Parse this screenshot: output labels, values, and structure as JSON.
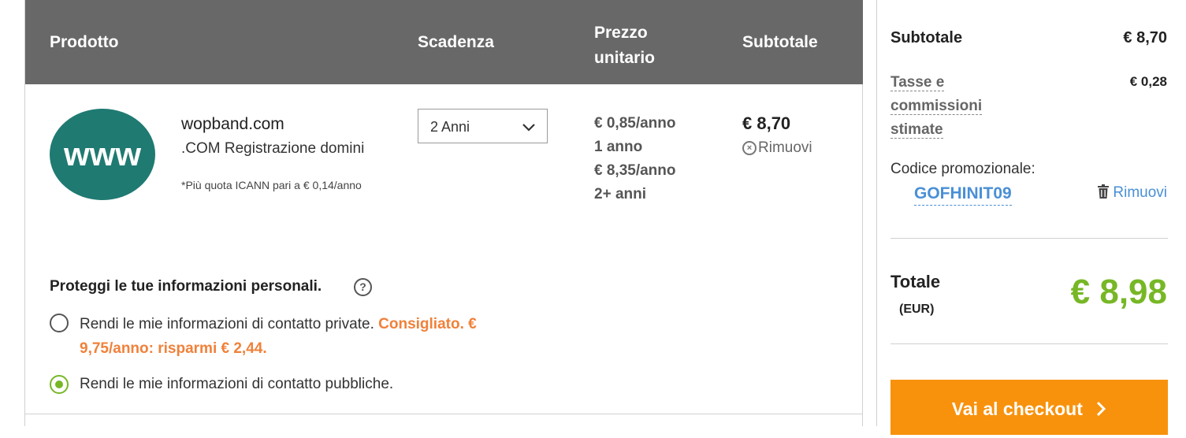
{
  "table": {
    "headers": {
      "product": "Prodotto",
      "expiry": "Scadenza",
      "unit_price": "Prezzo unitario",
      "subtotal": "Subtotale"
    }
  },
  "item": {
    "logo_text": "www",
    "name": "wopband.com",
    "type": ".COM Registrazione domini",
    "note": "*Più quota ICANN pari a € 0,14/anno",
    "duration_selected": "2 Anni",
    "prices": [
      "€ 0,85/anno",
      "1 anno",
      "€ 8,35/anno",
      "2+ anni"
    ],
    "subtotal": "€ 8,70",
    "remove_label": "Rimuovi"
  },
  "privacy": {
    "title": "Proteggi le tue informazioni personali.",
    "help_icon": "?",
    "option_private": "Rendi le mie informazioni di contatto private.",
    "option_private_recommended": "Consigliato. € 9,75/anno: risparmi € 2,44.",
    "option_public": "Rendi le mie informazioni di contatto pubbliche.",
    "selected": "public"
  },
  "summary": {
    "subtotal_label": "Subtotale",
    "subtotal_value": "€ 8,70",
    "tax_label": "Tasse e commissioni stimate",
    "tax_value": "€ 0,28",
    "promo_label": "Codice promozionale:",
    "promo_code": "GOFHINIT09",
    "promo_remove_label": "Rimuovi",
    "total_label": "Totale",
    "total_currency": "(EUR)",
    "total_value": "€ 8,98",
    "checkout_label": "Vai al checkout"
  },
  "colors": {
    "header_bg": "#686868",
    "accent_green": "#77b726",
    "accent_orange": "#f8920c",
    "link_blue": "#4a8fd6",
    "logo_teal": "#1f7a72"
  }
}
